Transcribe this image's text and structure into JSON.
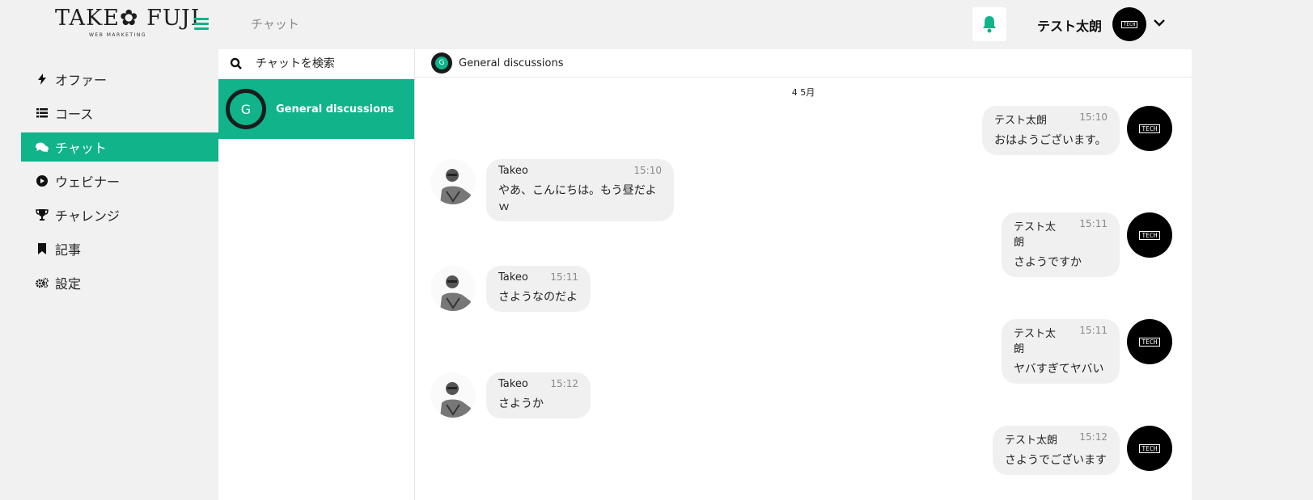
{
  "header": {
    "logo_text": "TAKE✿ FUJI",
    "logo_sub": "WEB MARKETING",
    "page_title": "チャット",
    "user_name": "テスト太朗",
    "avatar_text": "TECH"
  },
  "nav": {
    "items": [
      {
        "label": "オファー",
        "icon": "bolt-icon"
      },
      {
        "label": "コース",
        "icon": "list-icon"
      },
      {
        "label": "チャット",
        "icon": "comments-icon",
        "active": true
      },
      {
        "label": "ウェビナー",
        "icon": "play-circle-icon"
      },
      {
        "label": "チャレンジ",
        "icon": "trophy-icon"
      },
      {
        "label": "記事",
        "icon": "bookmark-icon"
      },
      {
        "label": "設定",
        "icon": "gears-icon"
      }
    ]
  },
  "chat_list": {
    "search_placeholder": "チャットを検索",
    "rooms": [
      {
        "initial": "G",
        "name": "General discussions"
      }
    ]
  },
  "conversation": {
    "room_initial": "G",
    "room_name": "General discussions",
    "date": "4 5月",
    "messages": [
      {
        "sender": "テスト太朗",
        "time": "15:10",
        "text": "おはようございます。",
        "mine": true
      },
      {
        "sender": "Takeo",
        "time": "15:10",
        "text": "やあ、こんにちは。もう昼だよｗ",
        "mine": false
      },
      {
        "sender": "テスト太朗",
        "time": "15:11",
        "text": "さようですか",
        "mine": true
      },
      {
        "sender": "Takeo",
        "time": "15:11",
        "text": "さようなのだよ",
        "mine": false
      },
      {
        "sender": "テスト太朗",
        "time": "15:11",
        "text": "ヤバすぎてヤバい",
        "mine": true
      },
      {
        "sender": "Takeo",
        "time": "15:12",
        "text": "さようか",
        "mine": false
      },
      {
        "sender": "テスト太朗",
        "time": "15:12",
        "text": "さようでございます",
        "mine": true
      }
    ]
  },
  "colors": {
    "accent": "#10b38a",
    "background": "#f1f1f1",
    "bubble": "#f0f0f0"
  }
}
